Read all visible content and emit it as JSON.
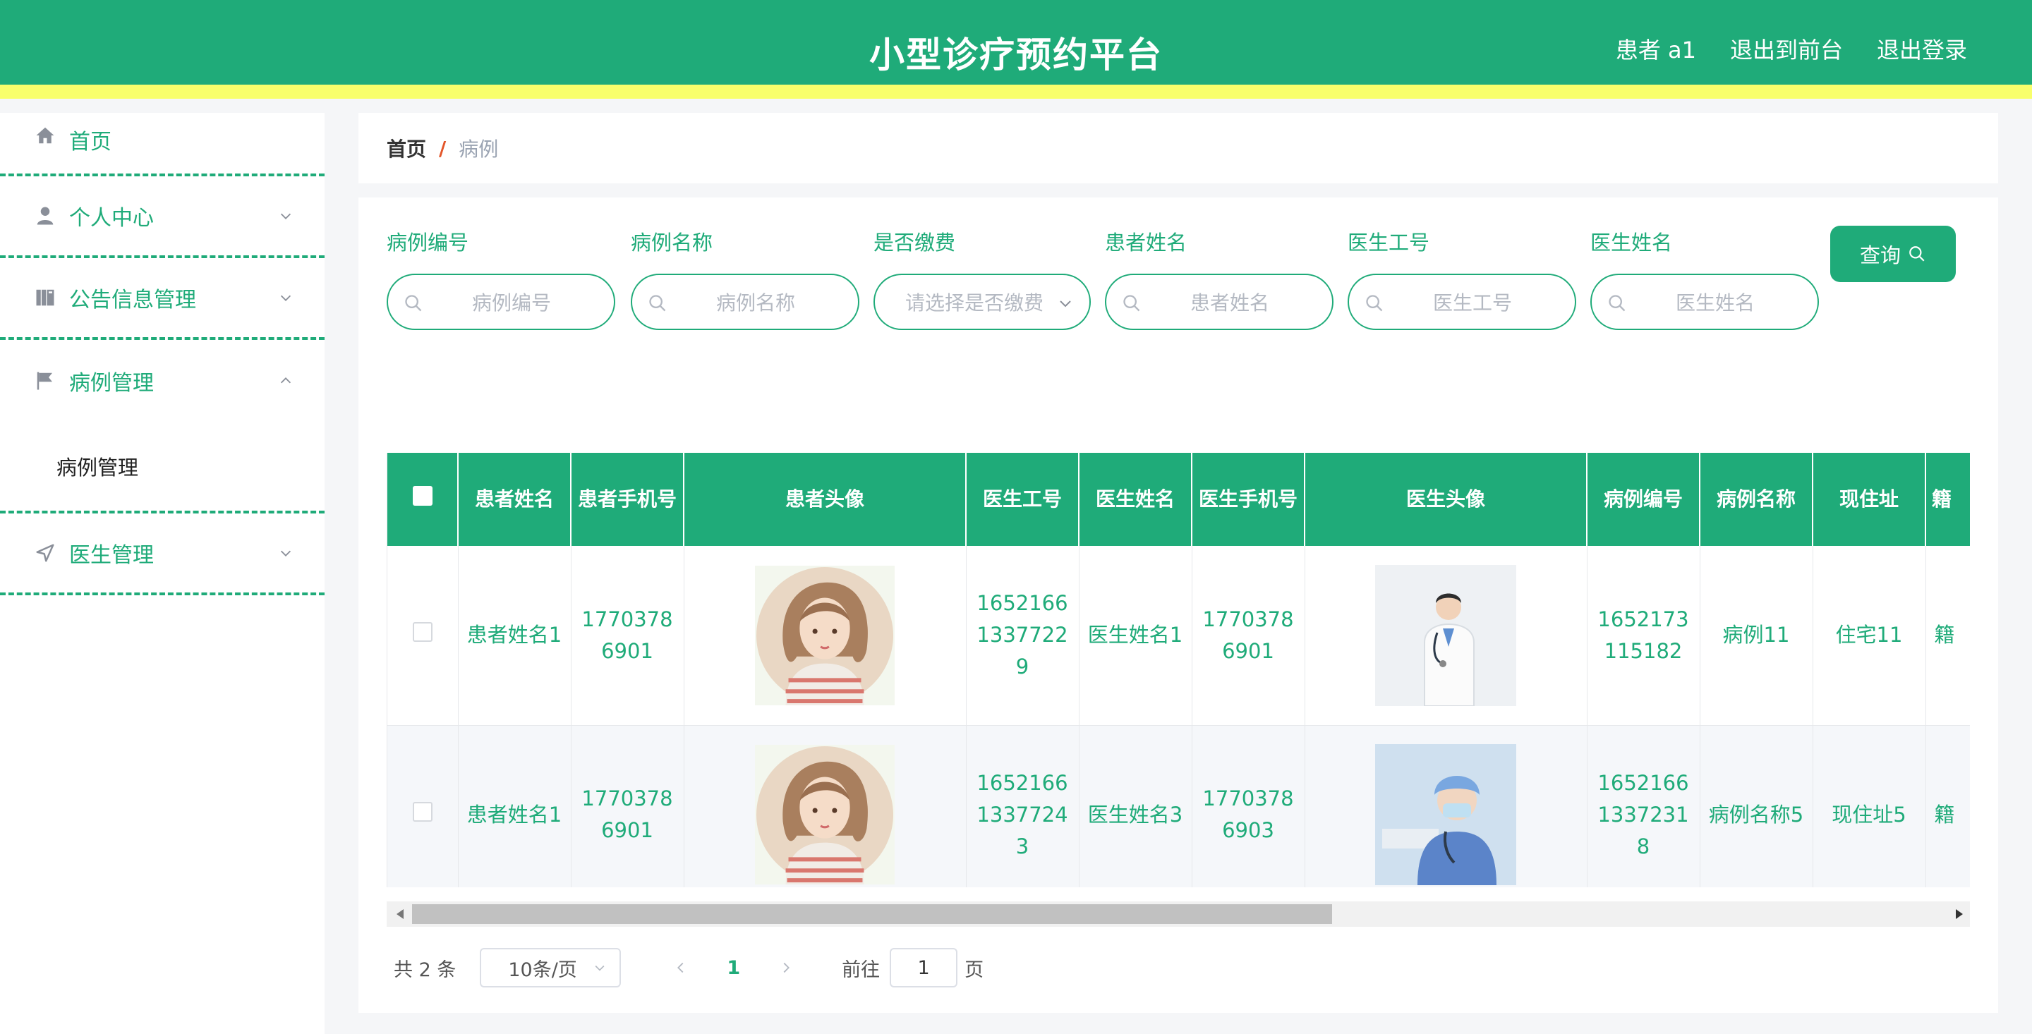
{
  "header": {
    "title": "小型诊疗预约平台",
    "user": "患者 a1",
    "back_front": "退出到前台",
    "logout": "退出登录"
  },
  "sidebar": {
    "items": [
      {
        "label": "首页",
        "icon": "home-icon"
      },
      {
        "label": "个人中心",
        "icon": "user-icon",
        "chevron": "down"
      },
      {
        "label": "公告信息管理",
        "icon": "book-icon",
        "chevron": "down"
      },
      {
        "label": "病例管理",
        "icon": "flag-icon",
        "chevron": "up",
        "children": [
          "病例管理"
        ]
      },
      {
        "label": "医生管理",
        "icon": "send-icon",
        "chevron": "down"
      }
    ]
  },
  "breadcrumb": {
    "home": "首页",
    "separator": "/",
    "current": "病例"
  },
  "filters": [
    {
      "label": "病例编号",
      "placeholder": "病例编号"
    },
    {
      "label": "病例名称",
      "placeholder": "病例名称"
    },
    {
      "label": "是否缴费",
      "placeholder": "请选择是否缴费"
    },
    {
      "label": "患者姓名",
      "placeholder": "患者姓名"
    },
    {
      "label": "医生工号",
      "placeholder": "医生工号"
    },
    {
      "label": "医生姓名",
      "placeholder": "医生姓名"
    }
  ],
  "query_button": "查询",
  "table": {
    "columns": [
      "患者姓名",
      "患者手机号",
      "患者头像",
      "医生工号",
      "医生姓名",
      "医生手机号",
      "医生头像",
      "病例编号",
      "病例名称",
      "现住址",
      "籍"
    ],
    "rows": [
      {
        "patient_name": "患者姓名1",
        "patient_phone": "17703786901",
        "doctor_no": "16521661337722 9",
        "doctor_name": "医生姓名1",
        "doctor_phone": "17703786901",
        "case_no": "1652173115182",
        "case_name": "病例11",
        "address": "住宅11",
        "native": "籍"
      },
      {
        "patient_name": "患者姓名1",
        "patient_phone": "17703786901",
        "doctor_no": "16521661337724 3",
        "doctor_name": "医生姓名3",
        "doctor_phone": "17703786903",
        "case_no": "16521661337231 8",
        "case_name": "病例名称5",
        "address": "现住址5",
        "native": "籍"
      }
    ]
  },
  "pagination": {
    "total": "共 2 条",
    "page_size": "10条/页",
    "current_page": "1",
    "goto_label": "前往",
    "goto_value": "1",
    "page_suffix": "页"
  },
  "colors": {
    "primary": "#1fab79",
    "header_stripe": "#f8ff6b",
    "breadcrumb_separator": "#e3562a"
  }
}
